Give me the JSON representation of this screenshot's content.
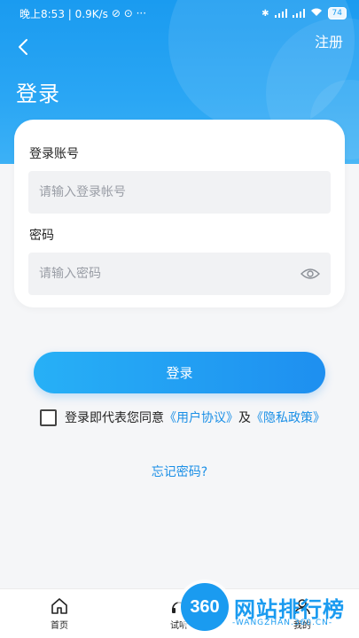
{
  "status_bar": {
    "time_speed": "晚上8:53 | 0.9K/s",
    "extra_icons": "⊘ ⊙ ···",
    "battery": "74"
  },
  "nav": {
    "register_label": "注册"
  },
  "page": {
    "title": "登录"
  },
  "form": {
    "account_label": "登录账号",
    "account_placeholder": "请输入登录帐号",
    "password_label": "密码",
    "password_placeholder": "请输入密码"
  },
  "login_button": "登录",
  "agreement": {
    "prefix": "登录即代表您同意",
    "user_agreement": "《用户协议》",
    "and": "及",
    "privacy_policy": "《隐私政策》"
  },
  "forgot_password": "忘记密码?",
  "tabbar": {
    "home": "首页",
    "listen": "试听",
    "mine": "我的"
  },
  "watermark": {
    "logo": "360",
    "name": "网站排行榜",
    "domain": "-WANGZHAN.360.CN-"
  },
  "colors": {
    "primary": "#1a9bf0",
    "link": "#1a8fe6"
  }
}
